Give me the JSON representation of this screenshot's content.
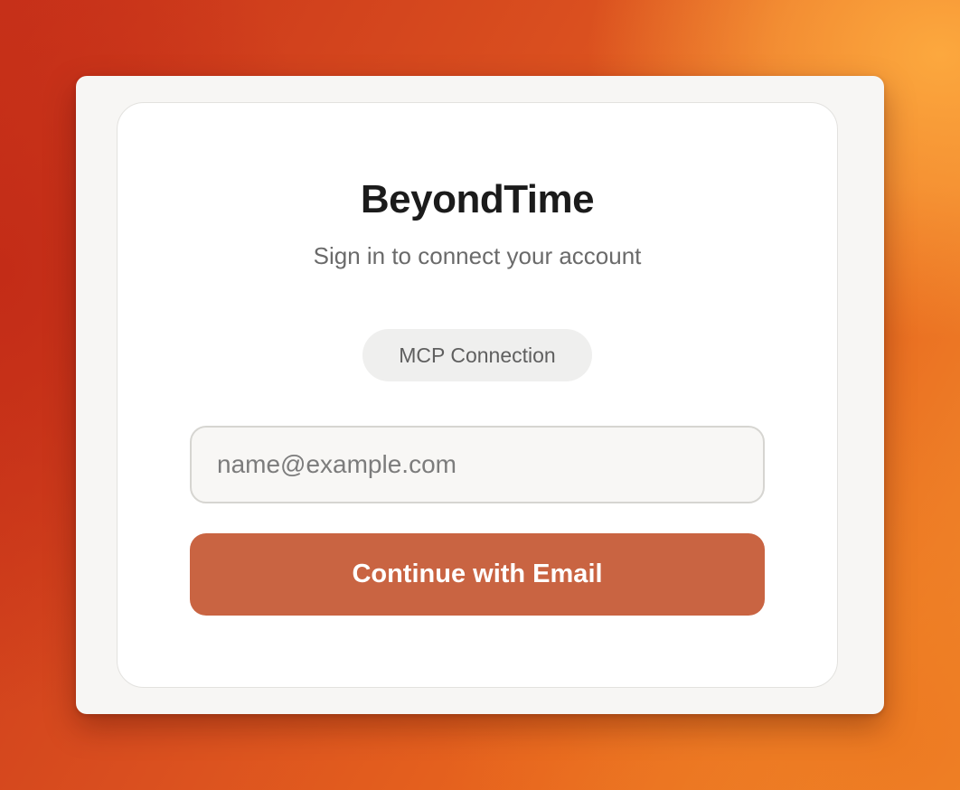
{
  "login": {
    "brand": "BeyondTime",
    "subtitle": "Sign in to connect your account",
    "badge": "MCP Connection",
    "email": {
      "value": "",
      "placeholder": "name@example.com"
    },
    "continue_label": "Continue with Email"
  },
  "colors": {
    "accent": "#c96442",
    "badge_bg": "#efefee",
    "card_bg": "#ffffff",
    "window_bg": "#f7f6f4"
  }
}
